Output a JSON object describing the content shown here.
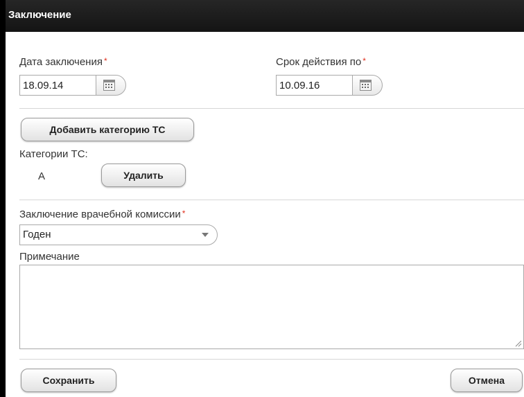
{
  "dialog": {
    "title": "Заключение"
  },
  "fields": {
    "conclusion_date": {
      "label": "Дата заключения",
      "required_mark": "*",
      "value": "18.09.14"
    },
    "valid_until": {
      "label": "Срок действия по",
      "required_mark": "*",
      "value": "10.09.16"
    }
  },
  "categories": {
    "add_button_label": "Добавить категорию ТС",
    "section_label": "Категории ТС:",
    "items": [
      {
        "name": "А",
        "delete_label": "Удалить"
      }
    ]
  },
  "commission": {
    "label": "Заключение врачебной комиссии",
    "required_mark": "*",
    "selected": "Годен"
  },
  "note": {
    "label": "Примечание",
    "value": ""
  },
  "actions": {
    "save_label": "Сохранить",
    "cancel_label": "Отмена"
  },
  "colors": {
    "titlebar": "#1c1c1c",
    "required": "#e0301e",
    "divider": "#d6d6d6"
  }
}
